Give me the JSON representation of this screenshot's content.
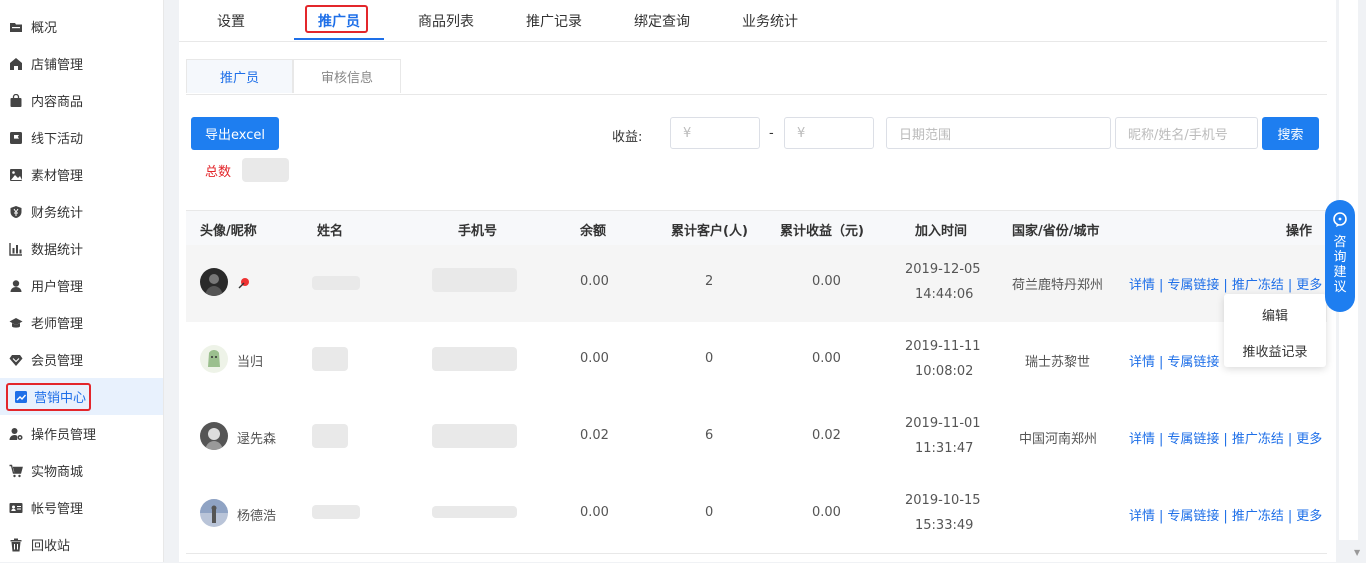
{
  "sidebar": {
    "items": [
      {
        "label": "概况",
        "icon": "folder-icon"
      },
      {
        "label": "店铺管理",
        "icon": "home-icon"
      },
      {
        "label": "内容商品",
        "icon": "bag-icon"
      },
      {
        "label": "线下活动",
        "icon": "flag-icon"
      },
      {
        "label": "素材管理",
        "icon": "image-icon"
      },
      {
        "label": "财务统计",
        "icon": "shield-yen-icon"
      },
      {
        "label": "数据统计",
        "icon": "bar-chart-icon"
      },
      {
        "label": "用户管理",
        "icon": "user-icon"
      },
      {
        "label": "老师管理",
        "icon": "graduation-cap-icon"
      },
      {
        "label": "会员管理",
        "icon": "diamond-icon"
      },
      {
        "label": "营销中心",
        "icon": "trend-chart-icon"
      },
      {
        "label": "操作员管理",
        "icon": "user-gear-icon"
      },
      {
        "label": "实物商城",
        "icon": "cart-icon"
      },
      {
        "label": "帐号管理",
        "icon": "id-card-icon"
      },
      {
        "label": "回收站",
        "icon": "trash-icon"
      }
    ],
    "active_index": 10
  },
  "top_tabs": [
    "设置",
    "推广员",
    "商品列表",
    "推广记录",
    "绑定查询",
    "业务统计"
  ],
  "sub_tabs": [
    "推广员",
    "审核信息"
  ],
  "toolbar": {
    "export_label": "导出excel",
    "total_label": "总数",
    "income_label": "收益:",
    "min_placeholder": "¥",
    "max_placeholder": "¥",
    "range_dash": "-",
    "date_placeholder": "日期范围",
    "keyword_placeholder": "昵称/姓名/手机号",
    "search_label": "搜索"
  },
  "table": {
    "headers": [
      "头像/昵称",
      "姓名",
      "手机号",
      "余额",
      "累计客户(人)",
      "累计收益（元)",
      "加入时间",
      "国家/省份/城市",
      "操作"
    ],
    "rows": [
      {
        "nickname": "",
        "balance": "0.00",
        "customers": "2",
        "income": "0.00",
        "date": "2019-12-05",
        "time": "14:44:06",
        "region": "荷兰鹿特丹郑州"
      },
      {
        "nickname": "当归",
        "balance": "0.00",
        "customers": "0",
        "income": "0.00",
        "date": "2019-11-11",
        "time": "10:08:02",
        "region": "瑞士苏黎世"
      },
      {
        "nickname": "逯先森",
        "balance": "0.02",
        "customers": "6",
        "income": "0.02",
        "date": "2019-11-01",
        "time": "11:31:47",
        "region": "中国河南郑州"
      },
      {
        "nickname": "杨德浩",
        "balance": "0.00",
        "customers": "0",
        "income": "0.00",
        "date": "2019-10-15",
        "time": "15:33:49",
        "region": ""
      }
    ],
    "actions": {
      "detail": "详情",
      "link": "专属链接",
      "freeze": "推广冻结",
      "more": "更多",
      "separator": "|"
    }
  },
  "dropdown": [
    "编辑",
    "推收益记录"
  ],
  "float_button": {
    "chars": [
      "咨",
      "询",
      "建",
      "议"
    ]
  },
  "colors": {
    "accent": "#1e7ef0",
    "highlight": "#e3262b"
  }
}
